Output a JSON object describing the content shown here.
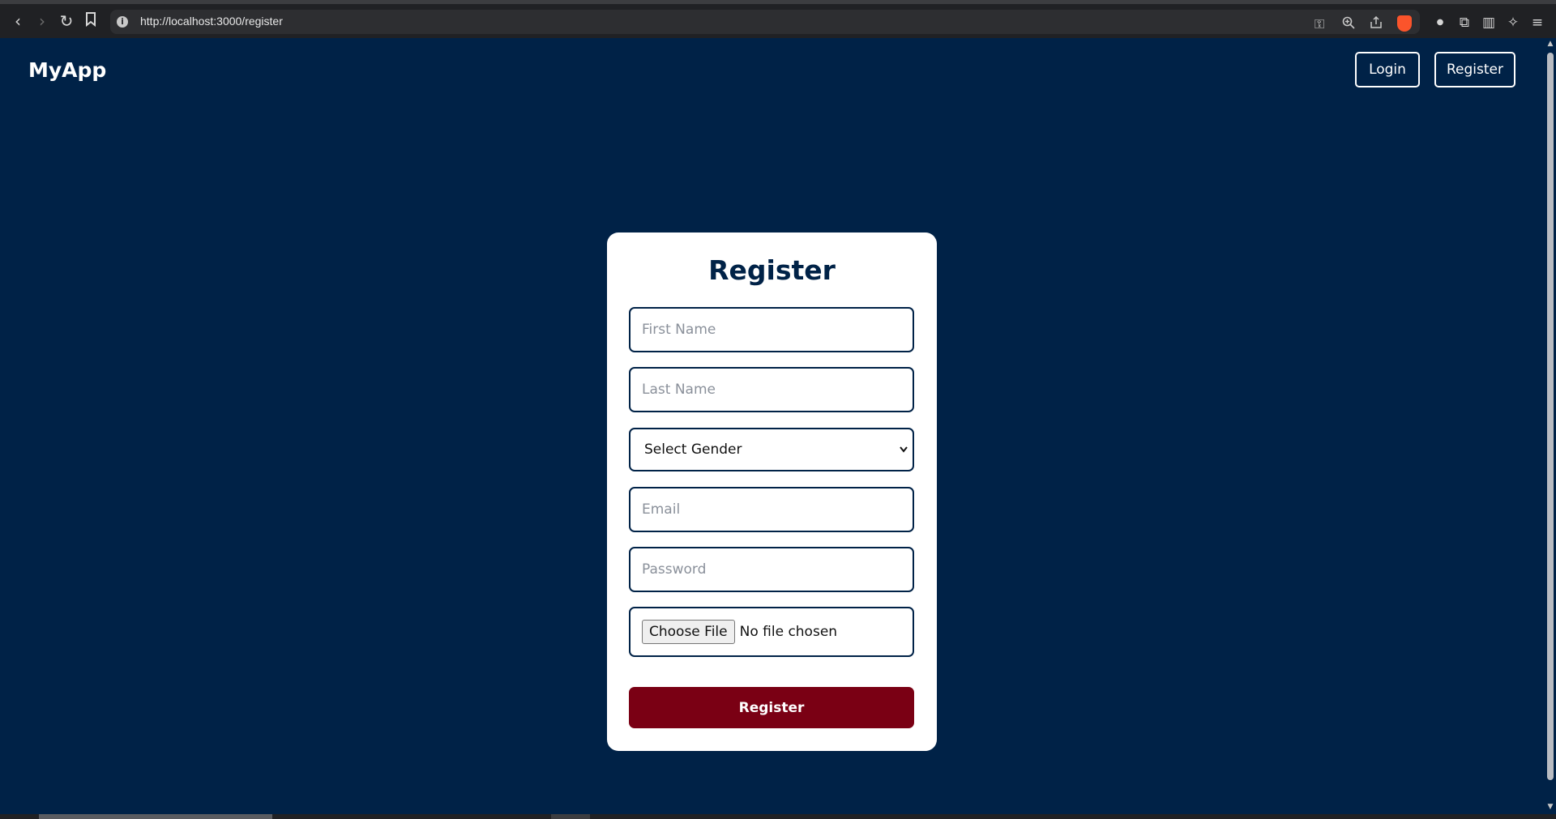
{
  "browser": {
    "url": "http://localhost:3000/register",
    "icons": {
      "back": "back-arrow-icon",
      "forward": "forward-arrow-icon",
      "reload": "reload-icon",
      "bookmark": "bookmark-icon",
      "info": "info-icon",
      "key": "key-icon",
      "zoom": "zoom-icon",
      "share": "share-icon",
      "brave": "brave-shield-icon",
      "extensions": "extensions-icon",
      "sidebar": "sidebar-icon",
      "leo": "leo-ai-icon",
      "menu": "menu-icon"
    }
  },
  "header": {
    "brand": "MyApp",
    "login_label": "Login",
    "register_label": "Register"
  },
  "form": {
    "title": "Register",
    "first_name_placeholder": "First Name",
    "last_name_placeholder": "Last Name",
    "gender_selected": "Select Gender",
    "email_placeholder": "Email",
    "password_placeholder": "Password",
    "file_button_label": "Choose File",
    "file_status": "No file chosen",
    "submit_label": "Register"
  },
  "colors": {
    "background": "#002247",
    "card": "#ffffff",
    "accent": "#7a0014",
    "title": "#002247"
  }
}
